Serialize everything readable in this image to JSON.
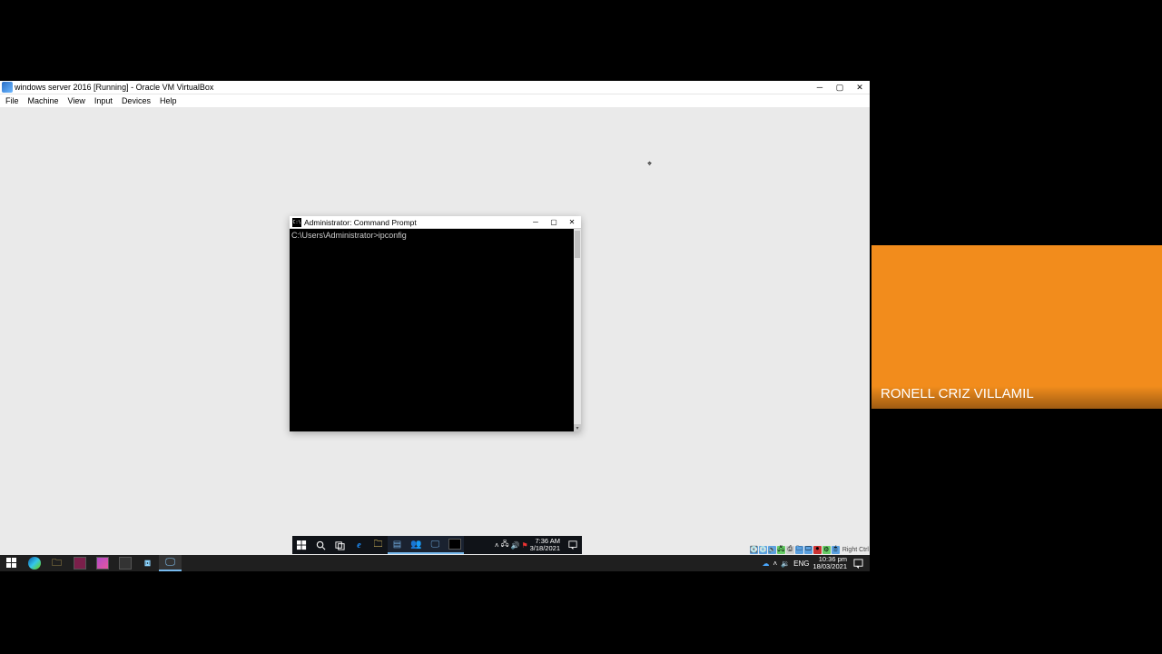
{
  "vbox": {
    "title": "windows server 2016 [Running] - Oracle VM VirtualBox",
    "menu": {
      "file": "File",
      "machine": "Machine",
      "view": "View",
      "input": "Input",
      "devices": "Devices",
      "help": "Help"
    },
    "status_text": "Right Ctrl"
  },
  "cmd": {
    "title": "Administrator: Command Prompt",
    "line1": "C:\\Users\\Administrator>ipconfig"
  },
  "guest_tray": {
    "time": "7:36 AM",
    "date": "3/18/2021"
  },
  "host_tray": {
    "lang": "ENG",
    "time": "10:36 pm",
    "date": "18/03/2021"
  },
  "overlay": {
    "participant_name": "RONELL CRIZ VILLAMIL"
  }
}
